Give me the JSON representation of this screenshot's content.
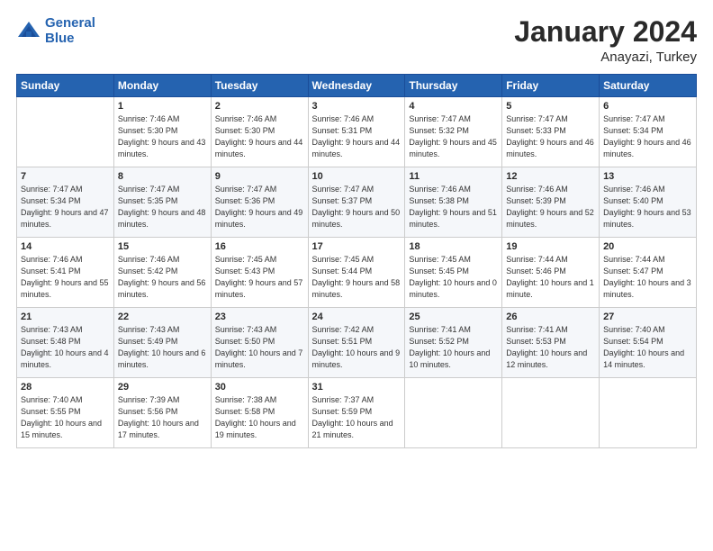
{
  "header": {
    "logo_line1": "General",
    "logo_line2": "Blue",
    "title": "January 2024",
    "subtitle": "Anayazi, Turkey"
  },
  "weekdays": [
    "Sunday",
    "Monday",
    "Tuesday",
    "Wednesday",
    "Thursday",
    "Friday",
    "Saturday"
  ],
  "weeks": [
    [
      {
        "day": "",
        "sunrise": "",
        "sunset": "",
        "daylight": ""
      },
      {
        "day": "1",
        "sunrise": "Sunrise: 7:46 AM",
        "sunset": "Sunset: 5:30 PM",
        "daylight": "Daylight: 9 hours and 43 minutes."
      },
      {
        "day": "2",
        "sunrise": "Sunrise: 7:46 AM",
        "sunset": "Sunset: 5:30 PM",
        "daylight": "Daylight: 9 hours and 44 minutes."
      },
      {
        "day": "3",
        "sunrise": "Sunrise: 7:46 AM",
        "sunset": "Sunset: 5:31 PM",
        "daylight": "Daylight: 9 hours and 44 minutes."
      },
      {
        "day": "4",
        "sunrise": "Sunrise: 7:47 AM",
        "sunset": "Sunset: 5:32 PM",
        "daylight": "Daylight: 9 hours and 45 minutes."
      },
      {
        "day": "5",
        "sunrise": "Sunrise: 7:47 AM",
        "sunset": "Sunset: 5:33 PM",
        "daylight": "Daylight: 9 hours and 46 minutes."
      },
      {
        "day": "6",
        "sunrise": "Sunrise: 7:47 AM",
        "sunset": "Sunset: 5:34 PM",
        "daylight": "Daylight: 9 hours and 46 minutes."
      }
    ],
    [
      {
        "day": "7",
        "sunrise": "Sunrise: 7:47 AM",
        "sunset": "Sunset: 5:34 PM",
        "daylight": "Daylight: 9 hours and 47 minutes."
      },
      {
        "day": "8",
        "sunrise": "Sunrise: 7:47 AM",
        "sunset": "Sunset: 5:35 PM",
        "daylight": "Daylight: 9 hours and 48 minutes."
      },
      {
        "day": "9",
        "sunrise": "Sunrise: 7:47 AM",
        "sunset": "Sunset: 5:36 PM",
        "daylight": "Daylight: 9 hours and 49 minutes."
      },
      {
        "day": "10",
        "sunrise": "Sunrise: 7:47 AM",
        "sunset": "Sunset: 5:37 PM",
        "daylight": "Daylight: 9 hours and 50 minutes."
      },
      {
        "day": "11",
        "sunrise": "Sunrise: 7:46 AM",
        "sunset": "Sunset: 5:38 PM",
        "daylight": "Daylight: 9 hours and 51 minutes."
      },
      {
        "day": "12",
        "sunrise": "Sunrise: 7:46 AM",
        "sunset": "Sunset: 5:39 PM",
        "daylight": "Daylight: 9 hours and 52 minutes."
      },
      {
        "day": "13",
        "sunrise": "Sunrise: 7:46 AM",
        "sunset": "Sunset: 5:40 PM",
        "daylight": "Daylight: 9 hours and 53 minutes."
      }
    ],
    [
      {
        "day": "14",
        "sunrise": "Sunrise: 7:46 AM",
        "sunset": "Sunset: 5:41 PM",
        "daylight": "Daylight: 9 hours and 55 minutes."
      },
      {
        "day": "15",
        "sunrise": "Sunrise: 7:46 AM",
        "sunset": "Sunset: 5:42 PM",
        "daylight": "Daylight: 9 hours and 56 minutes."
      },
      {
        "day": "16",
        "sunrise": "Sunrise: 7:45 AM",
        "sunset": "Sunset: 5:43 PM",
        "daylight": "Daylight: 9 hours and 57 minutes."
      },
      {
        "day": "17",
        "sunrise": "Sunrise: 7:45 AM",
        "sunset": "Sunset: 5:44 PM",
        "daylight": "Daylight: 9 hours and 58 minutes."
      },
      {
        "day": "18",
        "sunrise": "Sunrise: 7:45 AM",
        "sunset": "Sunset: 5:45 PM",
        "daylight": "Daylight: 10 hours and 0 minutes."
      },
      {
        "day": "19",
        "sunrise": "Sunrise: 7:44 AM",
        "sunset": "Sunset: 5:46 PM",
        "daylight": "Daylight: 10 hours and 1 minute."
      },
      {
        "day": "20",
        "sunrise": "Sunrise: 7:44 AM",
        "sunset": "Sunset: 5:47 PM",
        "daylight": "Daylight: 10 hours and 3 minutes."
      }
    ],
    [
      {
        "day": "21",
        "sunrise": "Sunrise: 7:43 AM",
        "sunset": "Sunset: 5:48 PM",
        "daylight": "Daylight: 10 hours and 4 minutes."
      },
      {
        "day": "22",
        "sunrise": "Sunrise: 7:43 AM",
        "sunset": "Sunset: 5:49 PM",
        "daylight": "Daylight: 10 hours and 6 minutes."
      },
      {
        "day": "23",
        "sunrise": "Sunrise: 7:43 AM",
        "sunset": "Sunset: 5:50 PM",
        "daylight": "Daylight: 10 hours and 7 minutes."
      },
      {
        "day": "24",
        "sunrise": "Sunrise: 7:42 AM",
        "sunset": "Sunset: 5:51 PM",
        "daylight": "Daylight: 10 hours and 9 minutes."
      },
      {
        "day": "25",
        "sunrise": "Sunrise: 7:41 AM",
        "sunset": "Sunset: 5:52 PM",
        "daylight": "Daylight: 10 hours and 10 minutes."
      },
      {
        "day": "26",
        "sunrise": "Sunrise: 7:41 AM",
        "sunset": "Sunset: 5:53 PM",
        "daylight": "Daylight: 10 hours and 12 minutes."
      },
      {
        "day": "27",
        "sunrise": "Sunrise: 7:40 AM",
        "sunset": "Sunset: 5:54 PM",
        "daylight": "Daylight: 10 hours and 14 minutes."
      }
    ],
    [
      {
        "day": "28",
        "sunrise": "Sunrise: 7:40 AM",
        "sunset": "Sunset: 5:55 PM",
        "daylight": "Daylight: 10 hours and 15 minutes."
      },
      {
        "day": "29",
        "sunrise": "Sunrise: 7:39 AM",
        "sunset": "Sunset: 5:56 PM",
        "daylight": "Daylight: 10 hours and 17 minutes."
      },
      {
        "day": "30",
        "sunrise": "Sunrise: 7:38 AM",
        "sunset": "Sunset: 5:58 PM",
        "daylight": "Daylight: 10 hours and 19 minutes."
      },
      {
        "day": "31",
        "sunrise": "Sunrise: 7:37 AM",
        "sunset": "Sunset: 5:59 PM",
        "daylight": "Daylight: 10 hours and 21 minutes."
      },
      {
        "day": "",
        "sunrise": "",
        "sunset": "",
        "daylight": ""
      },
      {
        "day": "",
        "sunrise": "",
        "sunset": "",
        "daylight": ""
      },
      {
        "day": "",
        "sunrise": "",
        "sunset": "",
        "daylight": ""
      }
    ]
  ]
}
